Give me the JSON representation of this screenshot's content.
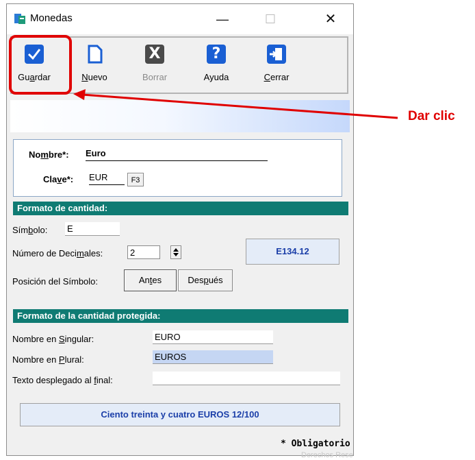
{
  "window": {
    "title": "Monedas",
    "controls": {
      "minimize": "—",
      "maximize": "☐",
      "close": "✕"
    }
  },
  "toolbar": [
    {
      "id": "guardar",
      "icon": "checkmark-icon",
      "label_pre": "Gu",
      "label_u": "a",
      "label_post": "rdar",
      "color": "#1a5fd3"
    },
    {
      "id": "nuevo",
      "icon": "new-document-icon",
      "label_pre": "",
      "label_u": "N",
      "label_post": "uevo",
      "color": "#1a5fd3"
    },
    {
      "id": "borrar",
      "icon": "delete-x-icon",
      "label_pre": "Borrar",
      "label_u": "",
      "label_post": "",
      "color": "#444444"
    },
    {
      "id": "ayuda",
      "icon": "help-question-icon",
      "label_pre": "Ayuda",
      "label_u": "",
      "label_post": "",
      "color": "#1a5fd3"
    },
    {
      "id": "cerrar",
      "icon": "exit-door-icon",
      "label_pre": "",
      "label_u": "C",
      "label_post": "errar",
      "color": "#1a5fd3"
    }
  ],
  "identity": {
    "nombre_label_pre": "No",
    "nombre_label_u": "m",
    "nombre_label_post": "bre*:",
    "nombre_value": "Euro",
    "clave_label_pre": "Cla",
    "clave_label_u": "v",
    "clave_label_post": "e*:",
    "clave_value": "EUR",
    "f3_label": "F3"
  },
  "formato_cantidad": {
    "header": "Formato de cantidad:",
    "simbolo_label_pre": "Sím",
    "simbolo_label_u": "b",
    "simbolo_label_post": "olo:",
    "simbolo_value": "E",
    "decimales_label_pre": "Número de Deci",
    "decimales_label_u": "m",
    "decimales_label_post": "ales:",
    "decimales_value": "2",
    "preview": "E134.12",
    "posicion_label": "Posición del Símbolo:",
    "antes_pre": "An",
    "antes_u": "t",
    "antes_post": "es",
    "despues_pre": "Des",
    "despues_u": "p",
    "despues_post": "ués"
  },
  "formato_protegida": {
    "header": "Formato de la cantidad protegida:",
    "singular_label_pre": "Nombre en ",
    "singular_label_u": "S",
    "singular_label_post": "ingular:",
    "singular_value": "EURO",
    "plural_label_pre": "Nombre en ",
    "plural_label_u": "P",
    "plural_label_post": "lural:",
    "plural_value": "EUROS",
    "texto_label_pre": "Texto desplegado al ",
    "texto_label_u": "f",
    "texto_label_post": "inal:",
    "texto_value": "",
    "preview": "Ciento treinta y cuatro EUROS 12/100"
  },
  "footer": {
    "obligatorio": "* Obligatorio",
    "watermark": "Derechos Rese"
  },
  "annotation": {
    "text": "Dar clic",
    "color": "#e00000"
  },
  "colors": {
    "accent": "#1a5fd3",
    "section": "#0f7b73",
    "preview_text": "#1a3ea8"
  }
}
